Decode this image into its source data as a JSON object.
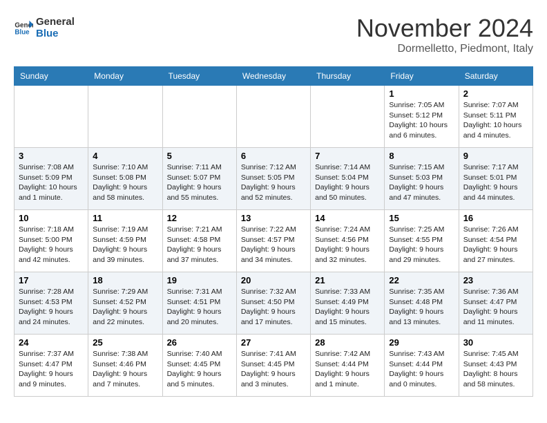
{
  "logo": {
    "text_general": "General",
    "text_blue": "Blue"
  },
  "title": "November 2024",
  "location": "Dormelletto, Piedmont, Italy",
  "days_of_week": [
    "Sunday",
    "Monday",
    "Tuesday",
    "Wednesday",
    "Thursday",
    "Friday",
    "Saturday"
  ],
  "weeks": [
    [
      {
        "day": null
      },
      {
        "day": null
      },
      {
        "day": null
      },
      {
        "day": null
      },
      {
        "day": null
      },
      {
        "day": "1",
        "info": "Sunrise: 7:05 AM\nSunset: 5:12 PM\nDaylight: 10 hours and 6 minutes."
      },
      {
        "day": "2",
        "info": "Sunrise: 7:07 AM\nSunset: 5:11 PM\nDaylight: 10 hours and 4 minutes."
      }
    ],
    [
      {
        "day": "3",
        "info": "Sunrise: 7:08 AM\nSunset: 5:09 PM\nDaylight: 10 hours and 1 minute."
      },
      {
        "day": "4",
        "info": "Sunrise: 7:10 AM\nSunset: 5:08 PM\nDaylight: 9 hours and 58 minutes."
      },
      {
        "day": "5",
        "info": "Sunrise: 7:11 AM\nSunset: 5:07 PM\nDaylight: 9 hours and 55 minutes."
      },
      {
        "day": "6",
        "info": "Sunrise: 7:12 AM\nSunset: 5:05 PM\nDaylight: 9 hours and 52 minutes."
      },
      {
        "day": "7",
        "info": "Sunrise: 7:14 AM\nSunset: 5:04 PM\nDaylight: 9 hours and 50 minutes."
      },
      {
        "day": "8",
        "info": "Sunrise: 7:15 AM\nSunset: 5:03 PM\nDaylight: 9 hours and 47 minutes."
      },
      {
        "day": "9",
        "info": "Sunrise: 7:17 AM\nSunset: 5:01 PM\nDaylight: 9 hours and 44 minutes."
      }
    ],
    [
      {
        "day": "10",
        "info": "Sunrise: 7:18 AM\nSunset: 5:00 PM\nDaylight: 9 hours and 42 minutes."
      },
      {
        "day": "11",
        "info": "Sunrise: 7:19 AM\nSunset: 4:59 PM\nDaylight: 9 hours and 39 minutes."
      },
      {
        "day": "12",
        "info": "Sunrise: 7:21 AM\nSunset: 4:58 PM\nDaylight: 9 hours and 37 minutes."
      },
      {
        "day": "13",
        "info": "Sunrise: 7:22 AM\nSunset: 4:57 PM\nDaylight: 9 hours and 34 minutes."
      },
      {
        "day": "14",
        "info": "Sunrise: 7:24 AM\nSunset: 4:56 PM\nDaylight: 9 hours and 32 minutes."
      },
      {
        "day": "15",
        "info": "Sunrise: 7:25 AM\nSunset: 4:55 PM\nDaylight: 9 hours and 29 minutes."
      },
      {
        "day": "16",
        "info": "Sunrise: 7:26 AM\nSunset: 4:54 PM\nDaylight: 9 hours and 27 minutes."
      }
    ],
    [
      {
        "day": "17",
        "info": "Sunrise: 7:28 AM\nSunset: 4:53 PM\nDaylight: 9 hours and 24 minutes."
      },
      {
        "day": "18",
        "info": "Sunrise: 7:29 AM\nSunset: 4:52 PM\nDaylight: 9 hours and 22 minutes."
      },
      {
        "day": "19",
        "info": "Sunrise: 7:31 AM\nSunset: 4:51 PM\nDaylight: 9 hours and 20 minutes."
      },
      {
        "day": "20",
        "info": "Sunrise: 7:32 AM\nSunset: 4:50 PM\nDaylight: 9 hours and 17 minutes."
      },
      {
        "day": "21",
        "info": "Sunrise: 7:33 AM\nSunset: 4:49 PM\nDaylight: 9 hours and 15 minutes."
      },
      {
        "day": "22",
        "info": "Sunrise: 7:35 AM\nSunset: 4:48 PM\nDaylight: 9 hours and 13 minutes."
      },
      {
        "day": "23",
        "info": "Sunrise: 7:36 AM\nSunset: 4:47 PM\nDaylight: 9 hours and 11 minutes."
      }
    ],
    [
      {
        "day": "24",
        "info": "Sunrise: 7:37 AM\nSunset: 4:47 PM\nDaylight: 9 hours and 9 minutes."
      },
      {
        "day": "25",
        "info": "Sunrise: 7:38 AM\nSunset: 4:46 PM\nDaylight: 9 hours and 7 minutes."
      },
      {
        "day": "26",
        "info": "Sunrise: 7:40 AM\nSunset: 4:45 PM\nDaylight: 9 hours and 5 minutes."
      },
      {
        "day": "27",
        "info": "Sunrise: 7:41 AM\nSunset: 4:45 PM\nDaylight: 9 hours and 3 minutes."
      },
      {
        "day": "28",
        "info": "Sunrise: 7:42 AM\nSunset: 4:44 PM\nDaylight: 9 hours and 1 minute."
      },
      {
        "day": "29",
        "info": "Sunrise: 7:43 AM\nSunset: 4:44 PM\nDaylight: 9 hours and 0 minutes."
      },
      {
        "day": "30",
        "info": "Sunrise: 7:45 AM\nSunset: 4:43 PM\nDaylight: 8 hours and 58 minutes."
      }
    ]
  ]
}
